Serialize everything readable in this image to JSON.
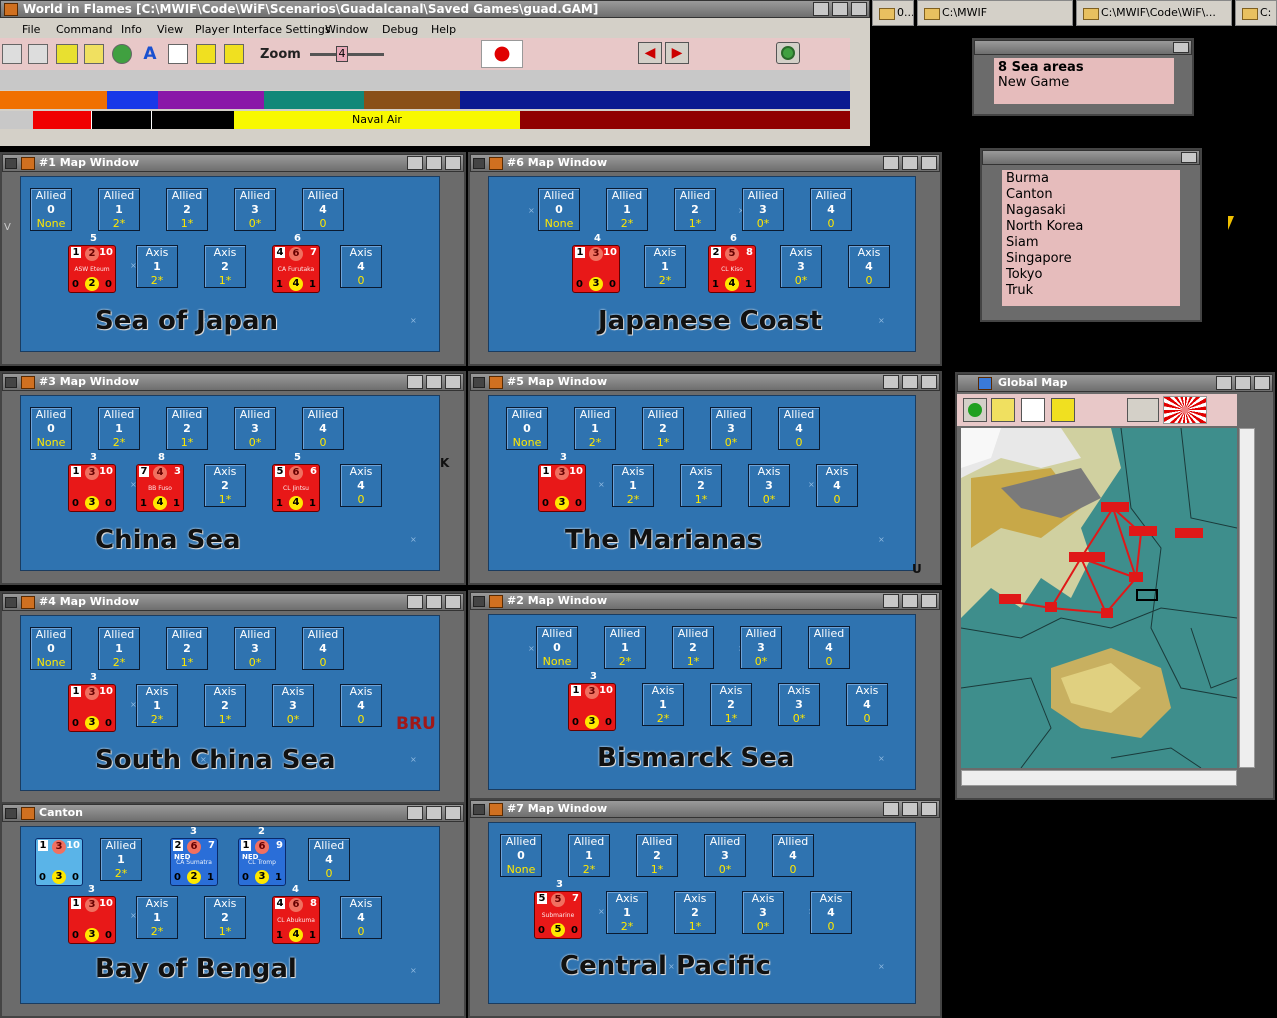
{
  "app": {
    "title": "World in Flames [C:\\MWIF\\Code\\WiF\\Scenarios\\Guadalcanal\\Saved Games\\guad.GAM]"
  },
  "taskbar": [
    {
      "label": "0..."
    },
    {
      "label": "C:\\MWIF"
    },
    {
      "label": "C:\\MWIF\\Code\\WiF\\..."
    },
    {
      "label": "C:"
    }
  ],
  "menu": [
    "File",
    "Command",
    "Info",
    "View",
    "Player Interface Settings",
    "Window",
    "Debug",
    "Help"
  ],
  "toolbar": {
    "zoom_label": "Zoom",
    "zoom_value": "4"
  },
  "strip": {
    "naval_air": "Naval Air"
  },
  "sea_areas": {
    "header": "8 Sea areas",
    "sub": "New Game"
  },
  "places": [
    "Burma",
    "Canton",
    "Nagasaki",
    "North Korea",
    "Siam",
    "Singapore",
    "Tokyo",
    "Truk"
  ],
  "global_map": {
    "title": "Global Map"
  },
  "boxes": {
    "allied": [
      {
        "t": "Allied",
        "n": "0",
        "s": "None"
      },
      {
        "t": "Allied",
        "n": "1",
        "s": "2*"
      },
      {
        "t": "Allied",
        "n": "2",
        "s": "1*"
      },
      {
        "t": "Allied",
        "n": "3",
        "s": "0*"
      },
      {
        "t": "Allied",
        "n": "4",
        "s": "0"
      }
    ],
    "axis": [
      {
        "t": "Axis",
        "n": "1",
        "s": "2*"
      },
      {
        "t": "Axis",
        "n": "2",
        "s": "1*"
      },
      {
        "t": "Axis",
        "n": "3",
        "s": "0*"
      },
      {
        "t": "Axis",
        "n": "4",
        "s": "0"
      }
    ]
  },
  "windows": [
    {
      "title": "#1 Map Window",
      "sea": "Sea of Japan"
    },
    {
      "title": "#6 Map Window",
      "sea": "Japanese Coast"
    },
    {
      "title": "#3 Map Window",
      "sea": "China Sea"
    },
    {
      "title": "#5 Map Window",
      "sea": "The Marianas"
    },
    {
      "title": "#4 Map Window",
      "sea": "South China Sea"
    },
    {
      "title": "#2 Map Window",
      "sea": "Bismarck Sea"
    },
    {
      "title": "Canton",
      "sea": "Bay of Bengal"
    },
    {
      "title": "#7 Map Window",
      "sea": "Central Pacific"
    }
  ],
  "map_labels": {
    "bru": "BRU",
    "k": "K",
    "u": "U",
    "v": "V"
  },
  "counters": {
    "asw": {
      "tl": "1",
      "c1": "2",
      "tr": "10",
      "mid": "ASW Eteum",
      "bl": "0",
      "c2": "2",
      "br": "0",
      "stack": "5"
    },
    "fubuki": {
      "tl": "4",
      "c1": "6",
      "tr": "7",
      "mid": "CA Furutaka",
      "bl": "1",
      "c2": "4",
      "br": "1",
      "stack": "6"
    },
    "kako": {
      "tl": "2",
      "c1": "5",
      "tr": "8",
      "mid": "CL Kiso",
      "bl": "1",
      "c2": "4",
      "br": "1",
      "stack": "6"
    },
    "sub": {
      "tl": "1",
      "c1": "3",
      "tr": "10",
      "mid": "",
      "bl": "0",
      "c2": "3",
      "br": "0"
    },
    "fuso": {
      "tl": "7",
      "c1": "4",
      "tr": "3",
      "mid": "BB Fuso",
      "bl": "1",
      "c2": "4",
      "br": "1",
      "stack": "8"
    },
    "jintsu": {
      "tl": "5",
      "c1": "6",
      "tr": "6",
      "mid": "CL Jintsu",
      "bl": "1",
      "c2": "4",
      "br": "1",
      "stack": "5"
    },
    "sumatra": {
      "tl": "2",
      "c1": "6",
      "tr": "7",
      "mid": "CA Sumatra",
      "badge": "NED",
      "bl": "0",
      "c2": "2",
      "br": "1",
      "stack": "3"
    },
    "tromp": {
      "tl": "1",
      "c1": "6",
      "tr": "9",
      "mid": "CL Tromp",
      "badge": "NED",
      "bl": "0",
      "c2": "3",
      "br": "1",
      "stack": "2"
    },
    "abukuma": {
      "tl": "4",
      "c1": "6",
      "tr": "8",
      "mid": "CL Abukuma",
      "bl": "1",
      "c2": "4",
      "br": "1",
      "stack": "4"
    },
    "submarine": {
      "tl": "5",
      "c1": "5",
      "tr": "7",
      "mid": "Submarine",
      "bl": "0",
      "c2": "5",
      "br": "0"
    }
  },
  "stacks": {
    "s3": "3",
    "s4": "4"
  },
  "colors": {
    "sea": "#2f73b0",
    "counter_red": "#e81818",
    "counter_blue": "#2a6ed8",
    "toolbar_pink": "#e8c8c8",
    "list_pink": "#e6bcbc"
  }
}
